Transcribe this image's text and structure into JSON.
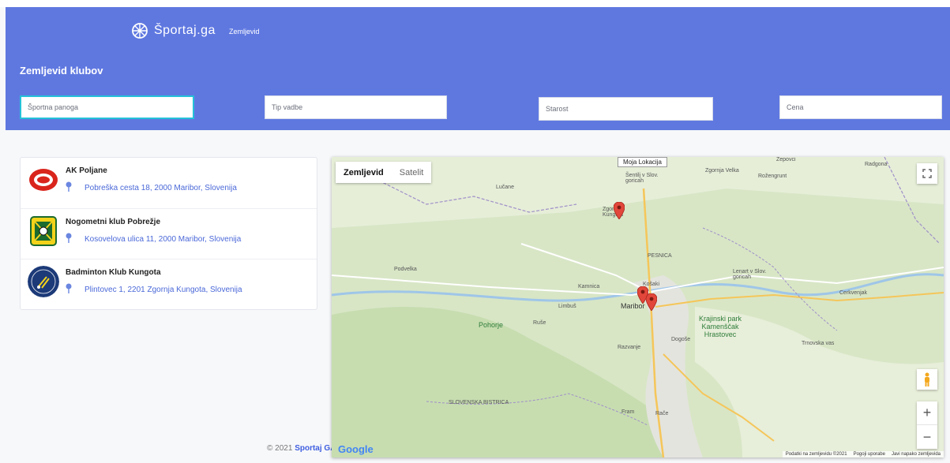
{
  "brand": {
    "name": "Športaj.ga",
    "logo_icon": "ball-icon"
  },
  "nav": {
    "map_link": "Zemljevid"
  },
  "page_title": "Zemljevid klubov",
  "filters": [
    {
      "placeholder": "Športna panoga"
    },
    {
      "placeholder": "Tip vadbe"
    },
    {
      "placeholder": "Starost"
    },
    {
      "placeholder": "Cena"
    }
  ],
  "clubs": [
    {
      "name": "AK Poljane",
      "address": "Pobreška cesta 18, 2000 Maribor, Slovenija"
    },
    {
      "name": "Nogometni klub Pobrežje",
      "address": "Kosovelova ulica 11, 2000 Maribor, Slovenija"
    },
    {
      "name": "Badminton Klub Kungota",
      "address": "Plintovec 1, 2201 Zgornja Kungota, Slovenija"
    }
  ],
  "footer": {
    "copyright": "© 2021",
    "brand": "Sportaj GA"
  },
  "map": {
    "type_map": "Zemljevid",
    "type_satellite": "Satelit",
    "my_location": "Moja Lokacija",
    "google": "Google",
    "attribution": [
      "Podatki na zemljevidu ©2021",
      "Pogoji uporabe",
      "Javi napako zemljevida"
    ],
    "labels": {
      "maribor": "Maribor",
      "pohorje": "Pohorje",
      "kungota": "Zgornja Kungota",
      "krajinski": "Krajinski park Kamenščak Hrastovec",
      "lenart": "Lenart v Slov. goricah",
      "rozengrunt": "Rožengrunt",
      "radgona": "Radgona",
      "sentilj": "Šentilj v Slov. goricah",
      "lucane": "Lučane",
      "ruse": "Ruše",
      "limbus": "Limbuš",
      "kamnica": "Kamnica",
      "pesnica": "PESNICA",
      "fram": "Fram",
      "race": "Rače",
      "slov_bistrica": "SLOVENSKA BISTRICA",
      "podvelka": "Podvelka",
      "kosaki": "Košaki",
      "razvanje": "Razvanje",
      "dogose": "Dogoše",
      "trnovska": "Trnovska vas",
      "cerkvenjak": "Cerkvenjak",
      "zgornja_velka": "Zgornja Velka",
      "zepovci": "Zepovci"
    }
  },
  "colors": {
    "header": "#5f78e0",
    "accent": "#4a68d8",
    "focus": "#25c1d8"
  }
}
